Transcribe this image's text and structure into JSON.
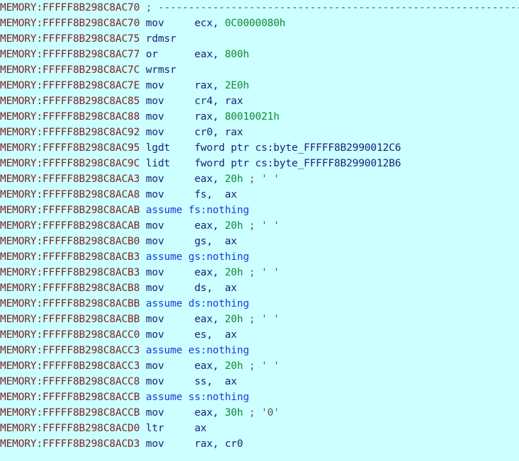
{
  "view": {
    "app": "IDA Pro disassembly listing",
    "segment": "MEMORY",
    "background_color": "#ccffff",
    "colors": {
      "address": "#7a2424",
      "mnemonic": "#18247a",
      "directive": "#1b3ae0",
      "register": "#18247a",
      "number": "#0f8a2f",
      "comment": "#5a5a48",
      "name": "#18247a"
    }
  },
  "lines": [
    {
      "address": "MEMORY:FFFFF8B298C8AC70",
      "kind": "comment",
      "comment": "; ------------------------------------------------------------------------"
    },
    {
      "address": "MEMORY:FFFFF8B298C8AC70",
      "kind": "insn",
      "mnemonic": "mov",
      "op1": "ecx,",
      "op2": "0C0000080h",
      "op2_type": "number"
    },
    {
      "address": "MEMORY:FFFFF8B298C8AC75",
      "kind": "insn",
      "mnemonic": "rdmsr"
    },
    {
      "address": "MEMORY:FFFFF8B298C8AC77",
      "kind": "insn",
      "mnemonic": "or",
      "op1": "eax,",
      "op2": "800h",
      "op2_type": "number"
    },
    {
      "address": "MEMORY:FFFFF8B298C8AC7C",
      "kind": "insn",
      "mnemonic": "wrmsr"
    },
    {
      "address": "MEMORY:FFFFF8B298C8AC7E",
      "kind": "insn",
      "mnemonic": "mov",
      "op1": "rax,",
      "op2": "2E0h",
      "op2_type": "number"
    },
    {
      "address": "MEMORY:FFFFF8B298C8AC85",
      "kind": "insn",
      "mnemonic": "mov",
      "op1": "cr4,",
      "op2": "rax",
      "op2_type": "register"
    },
    {
      "address": "MEMORY:FFFFF8B298C8AC88",
      "kind": "insn",
      "mnemonic": "mov",
      "op1": "rax,",
      "op2": "80010021h",
      "op2_type": "number"
    },
    {
      "address": "MEMORY:FFFFF8B298C8AC92",
      "kind": "insn",
      "mnemonic": "mov",
      "op1": "cr0,",
      "op2": "rax",
      "op2_type": "register"
    },
    {
      "address": "MEMORY:FFFFF8B298C8AC95",
      "kind": "insn",
      "mnemonic": "lgdt",
      "op1": "fword ptr cs:byte_FFFFF8B2990012C6",
      "op1_type": "name"
    },
    {
      "address": "MEMORY:FFFFF8B298C8AC9C",
      "kind": "insn",
      "mnemonic": "lidt",
      "op1": "fword ptr cs:byte_FFFFF8B2990012B6",
      "op1_type": "name"
    },
    {
      "address": "MEMORY:FFFFF8B298C8ACA3",
      "kind": "insn",
      "mnemonic": "mov",
      "op1": "eax,",
      "op2": "20h",
      "op2_type": "number",
      "comment": "; ' '"
    },
    {
      "address": "MEMORY:FFFFF8B298C8ACA8",
      "kind": "insn",
      "mnemonic": "mov",
      "op1": "fs,",
      "op2": "ax",
      "op2_type": "register"
    },
    {
      "address": "MEMORY:FFFFF8B298C8ACAB",
      "kind": "assume",
      "mnemonic": "assume",
      "op1": "fs:nothing"
    },
    {
      "address": "MEMORY:FFFFF8B298C8ACAB",
      "kind": "insn",
      "mnemonic": "mov",
      "op1": "eax,",
      "op2": "20h",
      "op2_type": "number",
      "comment": "; ' '"
    },
    {
      "address": "MEMORY:FFFFF8B298C8ACB0",
      "kind": "insn",
      "mnemonic": "mov",
      "op1": "gs,",
      "op2": "ax",
      "op2_type": "register"
    },
    {
      "address": "MEMORY:FFFFF8B298C8ACB3",
      "kind": "assume",
      "mnemonic": "assume",
      "op1": "gs:nothing"
    },
    {
      "address": "MEMORY:FFFFF8B298C8ACB3",
      "kind": "insn",
      "mnemonic": "mov",
      "op1": "eax,",
      "op2": "20h",
      "op2_type": "number",
      "comment": "; ' '"
    },
    {
      "address": "MEMORY:FFFFF8B298C8ACB8",
      "kind": "insn",
      "mnemonic": "mov",
      "op1": "ds,",
      "op2": "ax",
      "op2_type": "register"
    },
    {
      "address": "MEMORY:FFFFF8B298C8ACBB",
      "kind": "assume",
      "mnemonic": "assume",
      "op1": "ds:nothing"
    },
    {
      "address": "MEMORY:FFFFF8B298C8ACBB",
      "kind": "insn",
      "mnemonic": "mov",
      "op1": "eax,",
      "op2": "20h",
      "op2_type": "number",
      "comment": "; ' '"
    },
    {
      "address": "MEMORY:FFFFF8B298C8ACC0",
      "kind": "insn",
      "mnemonic": "mov",
      "op1": "es,",
      "op2": "ax",
      "op2_type": "register"
    },
    {
      "address": "MEMORY:FFFFF8B298C8ACC3",
      "kind": "assume",
      "mnemonic": "assume",
      "op1": "es:nothing"
    },
    {
      "address": "MEMORY:FFFFF8B298C8ACC3",
      "kind": "insn",
      "mnemonic": "mov",
      "op1": "eax,",
      "op2": "20h",
      "op2_type": "number",
      "comment": "; ' '"
    },
    {
      "address": "MEMORY:FFFFF8B298C8ACC8",
      "kind": "insn",
      "mnemonic": "mov",
      "op1": "ss,",
      "op2": "ax",
      "op2_type": "register"
    },
    {
      "address": "MEMORY:FFFFF8B298C8ACCB",
      "kind": "assume",
      "mnemonic": "assume",
      "op1": "ss:nothing"
    },
    {
      "address": "MEMORY:FFFFF8B298C8ACCB",
      "kind": "insn",
      "mnemonic": "mov",
      "op1": "eax,",
      "op2": "30h",
      "op2_type": "number",
      "comment": "; '0'"
    },
    {
      "address": "MEMORY:FFFFF8B298C8ACD0",
      "kind": "insn",
      "mnemonic": "ltr",
      "op1": "ax",
      "op1_type": "register"
    },
    {
      "address": "MEMORY:FFFFF8B298C8ACD3",
      "kind": "insn",
      "mnemonic": "mov",
      "op1": "rax,",
      "op2": "cr0",
      "op2_type": "register"
    }
  ]
}
